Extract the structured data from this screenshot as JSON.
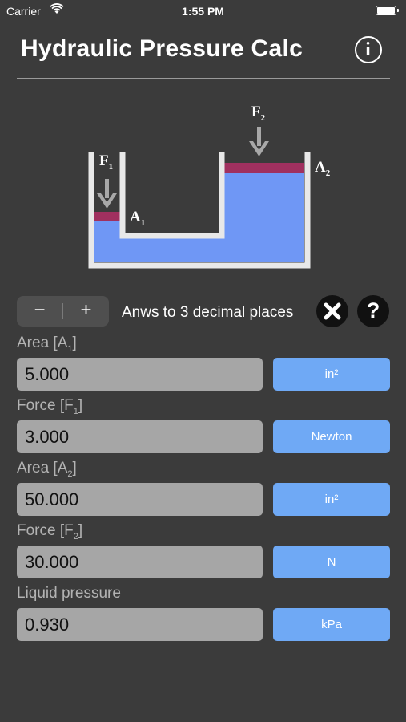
{
  "status_bar": {
    "carrier": "Carrier",
    "time": "1:55 PM"
  },
  "header": {
    "title": "Hydraulic Pressure Calc",
    "info_glyph": "i"
  },
  "diagram": {
    "f1_label": "F",
    "f1_sub": "1",
    "f2_label": "F",
    "f2_sub": "2",
    "a1_label": "A",
    "a1_sub": "1",
    "a2_label": "A",
    "a2_sub": "2",
    "colors": {
      "fluid": "#6f97f5",
      "piston": "#a0305f",
      "wall": "#e8e8e8",
      "arrow": "#a8a8a8"
    }
  },
  "controls": {
    "minus_label": "−",
    "plus_label": "+",
    "decimals_text": "Anws to 3 decimal places",
    "help_glyph": "?"
  },
  "fields": [
    {
      "label": "Area [A",
      "label_sub": "1",
      "label_end": "]",
      "value": "5.000",
      "unit": "in²"
    },
    {
      "label": "Force [F",
      "label_sub": "1",
      "label_end": "]",
      "value": "3.000",
      "unit": "Newton"
    },
    {
      "label": "Area [A",
      "label_sub": "2",
      "label_end": "]",
      "value": "50.000",
      "unit": "in²"
    },
    {
      "label": "Force [F",
      "label_sub": "2",
      "label_end": "]",
      "value": "30.000",
      "unit": "N"
    },
    {
      "label": "Liquid pressure",
      "label_sub": "",
      "label_end": "",
      "value": "0.930",
      "unit": "kPa"
    }
  ],
  "theme": {
    "background": "#3b3b3b",
    "accent": "#6fa9f5",
    "input_bg": "#a6a6a6"
  }
}
